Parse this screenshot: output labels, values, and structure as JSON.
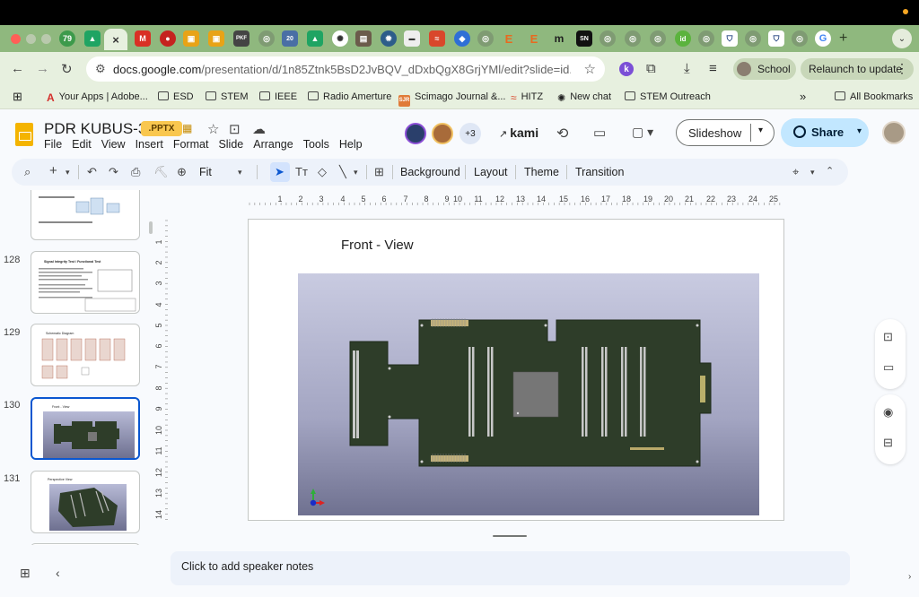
{
  "browser": {
    "url_host": "docs.google.com",
    "url_path": "/presentation/d/1n85Ztnk5BsD2JvBQV_dDxbQgX8GrjYMl/edit?slide=id.g369b...",
    "profile_label": "School",
    "relaunch_label": "Relaunch to update",
    "ext_k_label": "k",
    "new_tab_symbol": "+",
    "tabs_badge_text": [
      "79",
      "SN",
      "PKF",
      "20"
    ],
    "active_tab_close": "×"
  },
  "bookmarks": {
    "items": [
      {
        "label": "Your Apps | Adobe...",
        "icon": "adobe-icon"
      },
      {
        "label": "ESD",
        "icon": "folder-icon"
      },
      {
        "label": "STEM",
        "icon": "folder-icon"
      },
      {
        "label": "IEEE",
        "icon": "folder-icon"
      },
      {
        "label": "Radio Amerture",
        "icon": "folder-icon"
      },
      {
        "label": "Scimago Journal &...",
        "icon": "sjr-icon",
        "badge": "SJR"
      },
      {
        "label": "HITZ",
        "icon": "hitz-icon"
      },
      {
        "label": "New chat",
        "icon": "chat-icon"
      },
      {
        "label": "STEM Outreach",
        "icon": "folder-icon"
      }
    ],
    "more": "»",
    "all_bookmarks": "All Bookmarks"
  },
  "doc": {
    "title": "PDR KUBUS-3U",
    "badge": ".PPTX",
    "menu": [
      "File",
      "Edit",
      "View",
      "Insert",
      "Format",
      "Slide",
      "Arrange",
      "Tools",
      "Help"
    ],
    "collaborators_extra": "+3",
    "kami_label": "kami",
    "slideshow_label": "Slideshow",
    "share_label": "Share"
  },
  "toolbar": {
    "zoom_label": "Fit",
    "background_label": "Background",
    "layout_label": "Layout",
    "theme_label": "Theme",
    "transition_label": "Transition"
  },
  "filmstrip": {
    "slides": [
      {
        "number": "",
        "caption": ""
      },
      {
        "number": "128",
        "caption": "Signal Integrity Test / Functional Test"
      },
      {
        "number": "129",
        "caption": "Schematic Diagram"
      },
      {
        "number": "130",
        "caption": "Front - View",
        "selected": true
      },
      {
        "number": "131",
        "caption": "Perspective View"
      }
    ]
  },
  "ruler": {
    "h_ticks": [
      "1",
      "2",
      "3",
      "4",
      "5",
      "6",
      "7",
      "8",
      "9",
      "10",
      "11",
      "12",
      "13",
      "14",
      "15",
      "16",
      "17",
      "18",
      "19",
      "20",
      "21",
      "22",
      "23",
      "24",
      "25"
    ],
    "v_ticks": [
      "1",
      "2",
      "3",
      "4",
      "5",
      "6",
      "7",
      "8",
      "9",
      "10",
      "11",
      "12",
      "13",
      "14"
    ]
  },
  "slide": {
    "title": "Front - View"
  },
  "notes": {
    "placeholder": "Click to add speaker notes"
  },
  "colors": {
    "tabstrip": "#8fb87e",
    "toolbar_bg": "#e7f0df",
    "pcb_green": "#2e3d29",
    "selection_blue": "#0b57d0",
    "share_bg": "#c2e7ff"
  }
}
